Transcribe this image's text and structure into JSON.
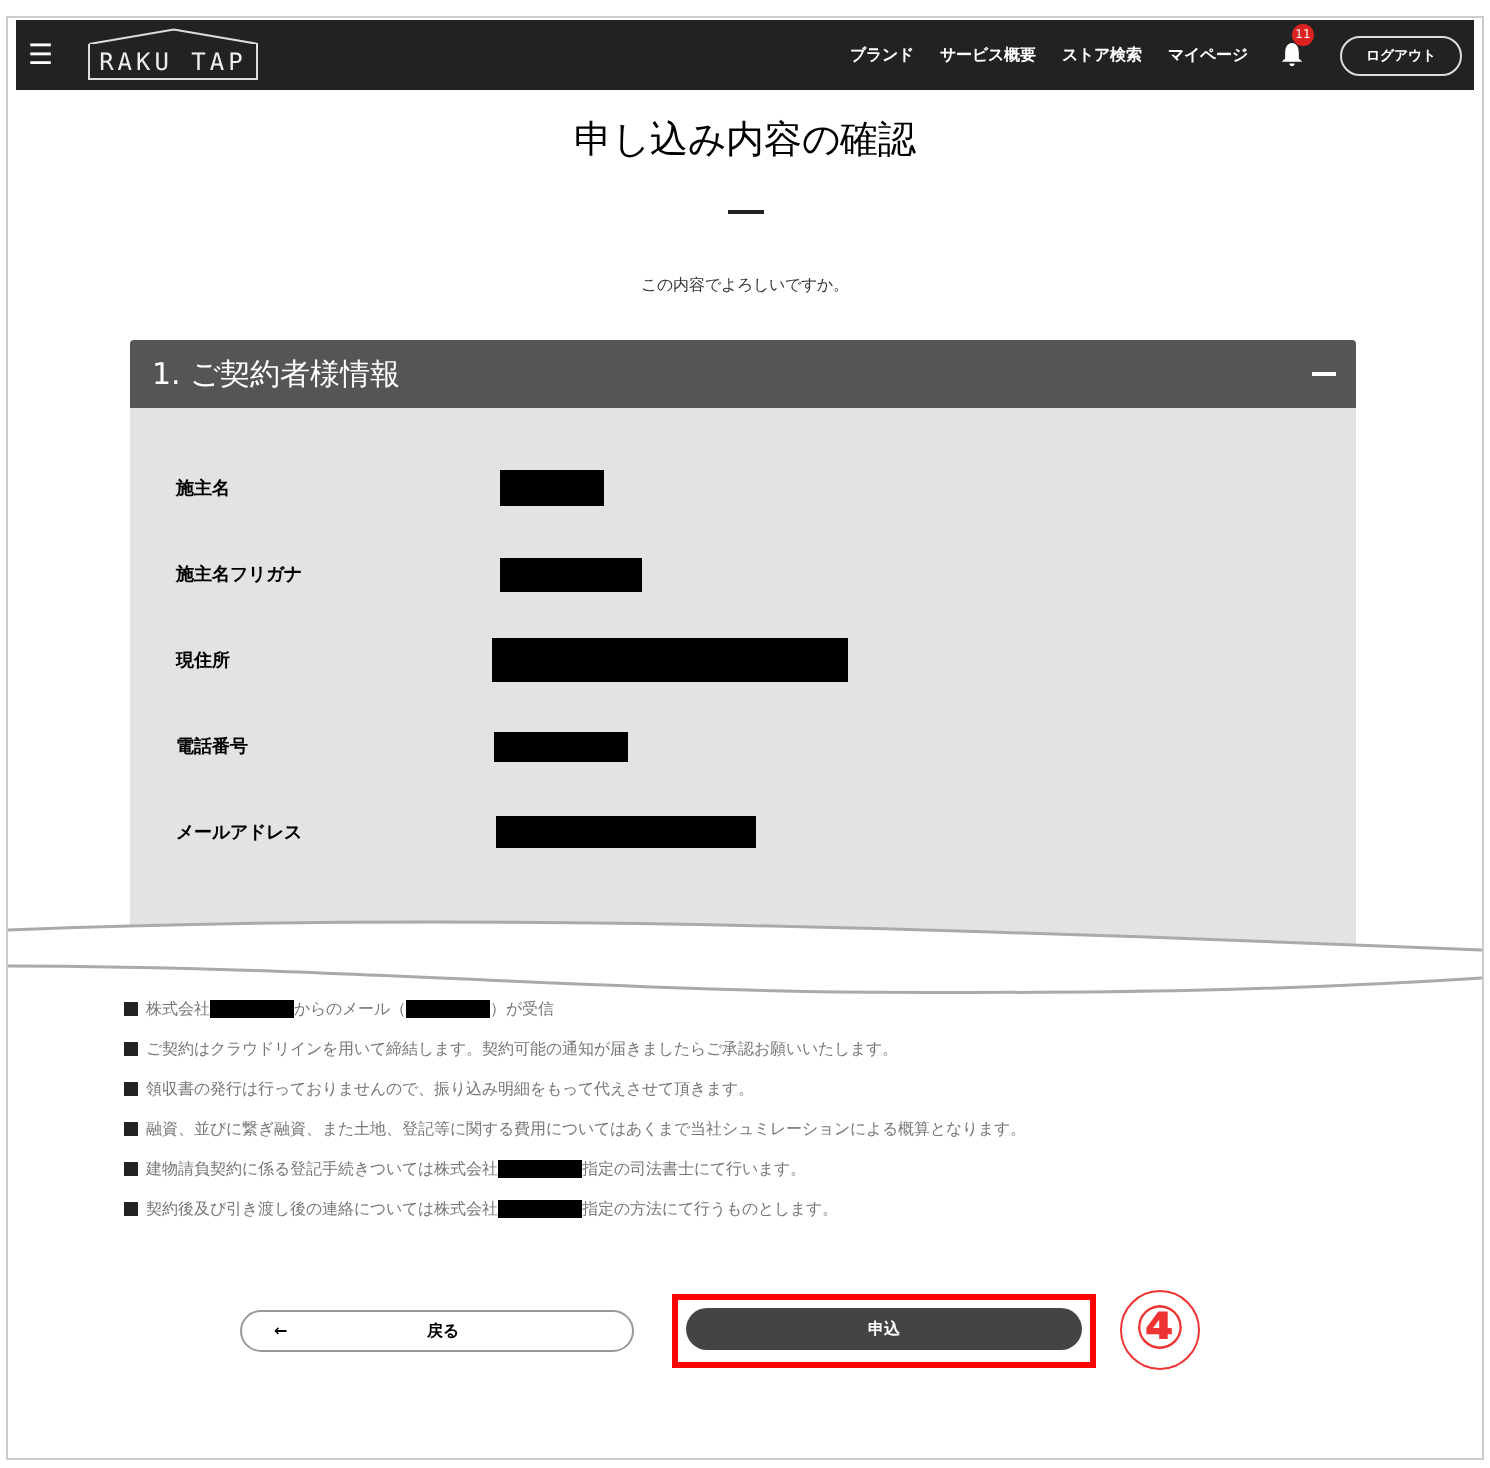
{
  "navbar": {
    "menu_icon": "☰",
    "logo": "RAKU TAP",
    "links": [
      {
        "label": "ブランド"
      },
      {
        "label": "サービス概要"
      },
      {
        "label": "ストア検索"
      },
      {
        "label": "マイページ"
      }
    ],
    "notification_count": "11",
    "logout": "ログアウト"
  },
  "page": {
    "title": "申し込み内容の確認",
    "subtitle": "この内容でよろしいですか。"
  },
  "section": {
    "title": "1. ご契約者様情報",
    "expanded": true,
    "fields": [
      {
        "label": "施主名",
        "redacted": true
      },
      {
        "label": "施主名フリガナ",
        "redacted": true
      },
      {
        "label": "現住所",
        "redacted": true
      },
      {
        "label": "電話番号",
        "redacted": true
      },
      {
        "label": "メールアドレス",
        "redacted": true
      }
    ]
  },
  "notices": [
    {
      "segments": [
        {
          "kind": "text",
          "text": "株式会社"
        },
        {
          "kind": "redaction"
        },
        {
          "kind": "text",
          "text": "からのメール（"
        },
        {
          "kind": "redaction"
        },
        {
          "kind": "text",
          "text": "）が受信"
        }
      ]
    },
    {
      "segments": [
        {
          "kind": "text",
          "text": "ご契約はクラウドリインを用いて締結します。契約可能の通知が届きましたらご承認お願いいたします。"
        }
      ]
    },
    {
      "segments": [
        {
          "kind": "text",
          "text": "領収書の発行は行っておりませんので、振り込み明細をもって代えさせて頂きます。"
        }
      ]
    },
    {
      "segments": [
        {
          "kind": "text",
          "text": "融資、並びに繋ぎ融資、また土地、登記等に関する費用についてはあくまで当社シュミレーションによる概算となります。"
        }
      ]
    },
    {
      "segments": [
        {
          "kind": "text",
          "text": "建物請負契約に係る登記手続きついては株式会社"
        },
        {
          "kind": "redaction"
        },
        {
          "kind": "text",
          "text": "指定の司法書士にて行います。"
        }
      ]
    },
    {
      "segments": [
        {
          "kind": "text",
          "text": "契約後及び引き渡し後の連絡については株式会社"
        },
        {
          "kind": "redaction"
        },
        {
          "kind": "text",
          "text": "指定の方法にて行うものとします。"
        }
      ]
    }
  ],
  "buttons": {
    "back": {
      "arrow": "←",
      "label": "戻る"
    },
    "submit": {
      "label": "申込"
    }
  },
  "annotation": {
    "label": "④",
    "highlighted": true
  }
}
